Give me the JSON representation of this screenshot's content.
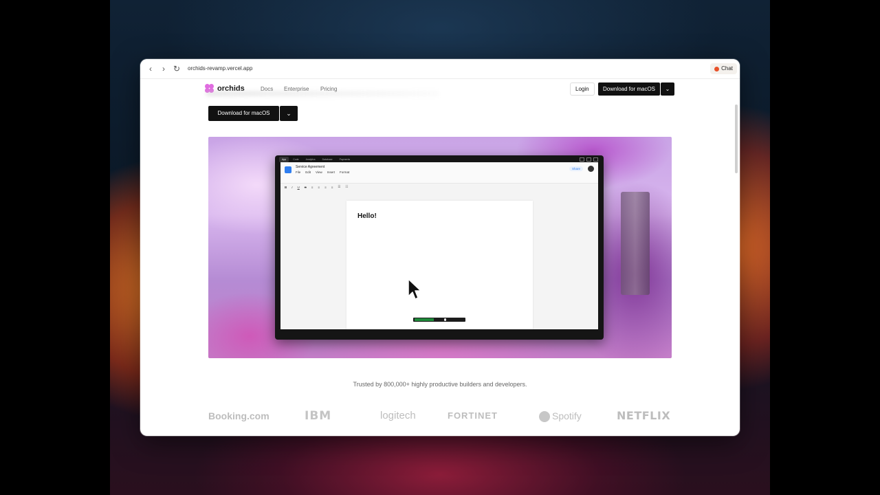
{
  "browser": {
    "url": "orchids-revamp.vercel.app",
    "chat_label": "Chat",
    "back_glyph": "‹",
    "forward_glyph": "›",
    "reload_glyph": "↻"
  },
  "site": {
    "brand": "orchids",
    "nav": [
      "Docs",
      "Enterprise",
      "Pricing"
    ],
    "login_label": "Login",
    "download_label": "Download for macOS",
    "caret": "⌄",
    "accent": "#e06ce0"
  },
  "hero": {
    "download_label": "Download for macOS",
    "caret": "⌄"
  },
  "app_preview": {
    "tabs": [
      "App",
      "Code",
      "Analytics",
      "Database",
      "Payments"
    ],
    "doc_title": "Service Agreement",
    "menus": [
      "File",
      "Edit",
      "View",
      "Insert",
      "Format"
    ],
    "share_label": "Share",
    "toolbar": [
      "B",
      "I",
      "U",
      "S",
      "≡",
      "≡",
      "≡",
      "≡",
      "☰",
      "☷"
    ],
    "content": "Hello!"
  },
  "social_proof": {
    "text": "Trusted by 800,000+ highly productive builders and developers.",
    "logos": [
      "Booking.com",
      "IBM",
      "logitech",
      "FORTINET",
      "Spotify",
      "NETFLIX"
    ]
  }
}
